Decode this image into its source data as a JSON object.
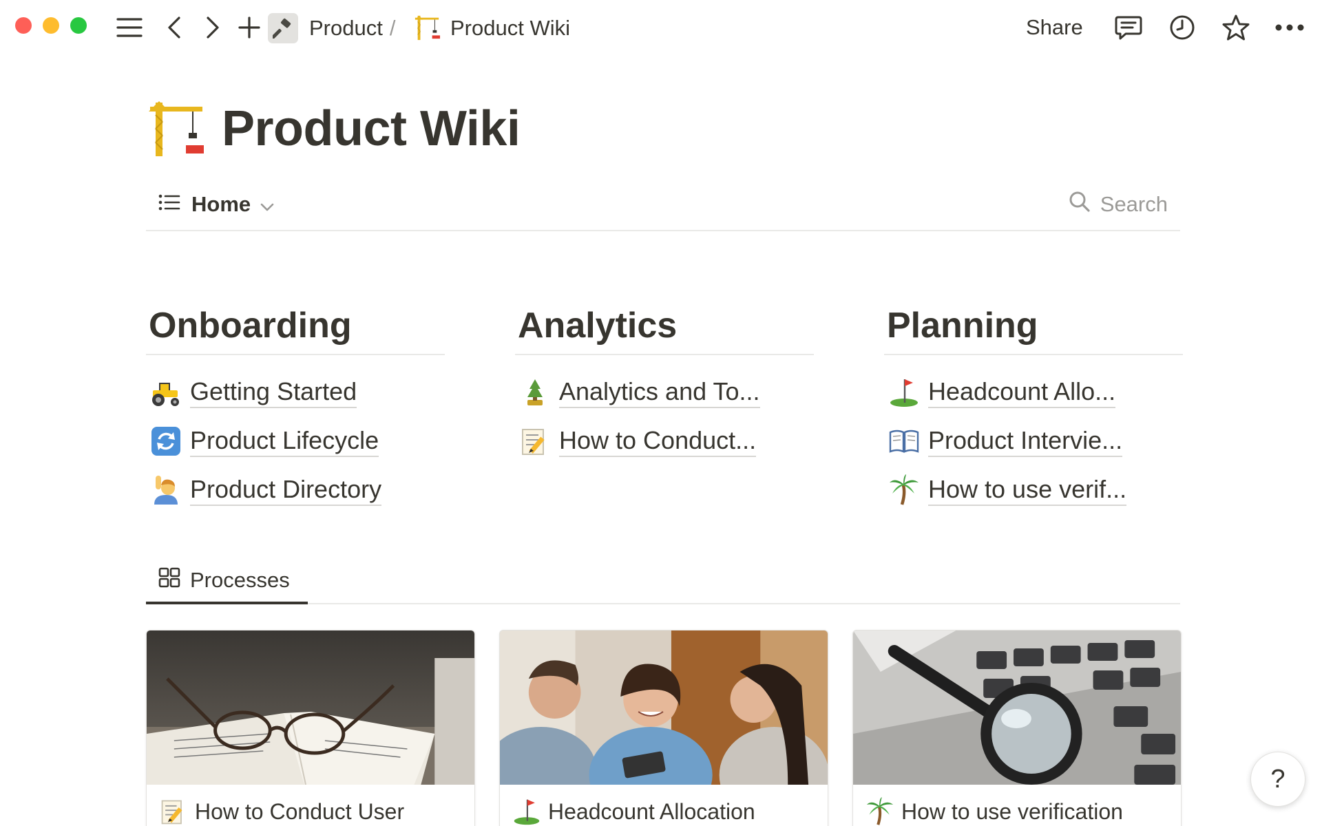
{
  "window": {
    "traffic_lights": [
      "close",
      "minimize",
      "zoom"
    ]
  },
  "topbar": {
    "breadcrumb": [
      {
        "label": "Product",
        "icon": "hammer-icon",
        "separator": "/"
      },
      {
        "label": "Product Wiki",
        "icon": "construction-crane-icon"
      }
    ],
    "share_label": "Share",
    "icons": [
      "menu-icon",
      "back-icon",
      "forward-icon",
      "add-icon",
      "comment-icon",
      "clock-icon",
      "star-icon",
      "more-icon"
    ]
  },
  "page": {
    "title": "Product Wiki",
    "title_icon": "construction-crane-icon"
  },
  "viewbar": {
    "view_label": "Home",
    "search_label": "Search"
  },
  "columns": [
    {
      "title": "Onboarding",
      "items": [
        {
          "label": "Getting Started",
          "icon": "tractor-icon"
        },
        {
          "label": "Product Lifecycle",
          "icon": "arrows-cycle-icon"
        },
        {
          "label": "Product Directory",
          "icon": "person-raising-hand-icon"
        }
      ]
    },
    {
      "title": "Analytics",
      "items": [
        {
          "label": "Analytics and To...",
          "icon": "tree-icon"
        },
        {
          "label": "How to Conduct...",
          "icon": "memo-icon"
        }
      ]
    },
    {
      "title": "Planning",
      "items": [
        {
          "label": "Headcount Allo...",
          "icon": "golf-flag-icon"
        },
        {
          "label": "Product Intervie...",
          "icon": "open-book-icon"
        },
        {
          "label": "How to use verif...",
          "icon": "palm-tree-icon"
        }
      ]
    }
  ],
  "tabs": {
    "active_label": "Processes",
    "icon": "gallery-grid-icon"
  },
  "cards": [
    {
      "caption": "How to Conduct User",
      "icon": "memo-icon",
      "image": "glasses-on-notebook"
    },
    {
      "caption": "Headcount Allocation",
      "icon": "golf-flag-icon",
      "image": "team-meeting"
    },
    {
      "caption": "How to use verification",
      "icon": "palm-tree-icon",
      "image": "magnifier-on-keyboard"
    }
  ],
  "help": {
    "label": "?"
  },
  "colors": {
    "text": "#37352f",
    "muted": "#9b9a97",
    "divider": "#e9e9e7",
    "traffic_red": "#fe5f57",
    "traffic_yellow": "#febc2e",
    "traffic_green": "#28c840"
  }
}
